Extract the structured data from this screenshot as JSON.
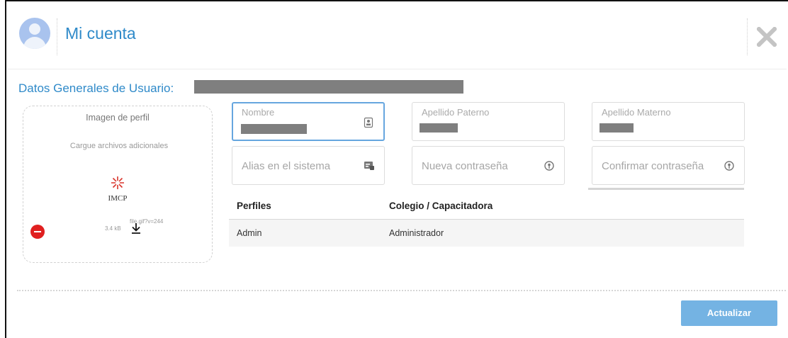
{
  "header": {
    "title": "Mi cuenta"
  },
  "section": {
    "title": "Datos Generales de Usuario:"
  },
  "profile_image": {
    "label": "Imagen de perfil",
    "upload_text": "Cargue archivos adicionales",
    "logo_text": "IMCP",
    "file_name": "file.gif?v=244",
    "file_size": "3.4 kB"
  },
  "fields": {
    "nombre_label": "Nombre",
    "apellido_paterno_label": "Apellido Paterno",
    "apellido_materno_label": "Apellido Materno",
    "alias_placeholder": "Alias en el sistema",
    "nueva_contrasena_placeholder": "Nueva contraseña",
    "confirmar_contrasena_placeholder": "Confirmar contraseña"
  },
  "table": {
    "headers": [
      "Perfiles",
      "Colegio / Capacitadora"
    ],
    "rows": [
      [
        "Admin",
        "Administrador"
      ]
    ]
  },
  "actions": {
    "update_label": "Actualizar"
  },
  "icons": {
    "close": "close-icon",
    "id_card": "id-card-icon",
    "alias": "alias-icon",
    "key": "key-icon",
    "download": "download-icon",
    "remove": "remove-icon"
  },
  "colors": {
    "accent": "#2f8ac9",
    "button": "#74b3e3",
    "focus_border": "#66a6df",
    "remove": "#e02020"
  }
}
